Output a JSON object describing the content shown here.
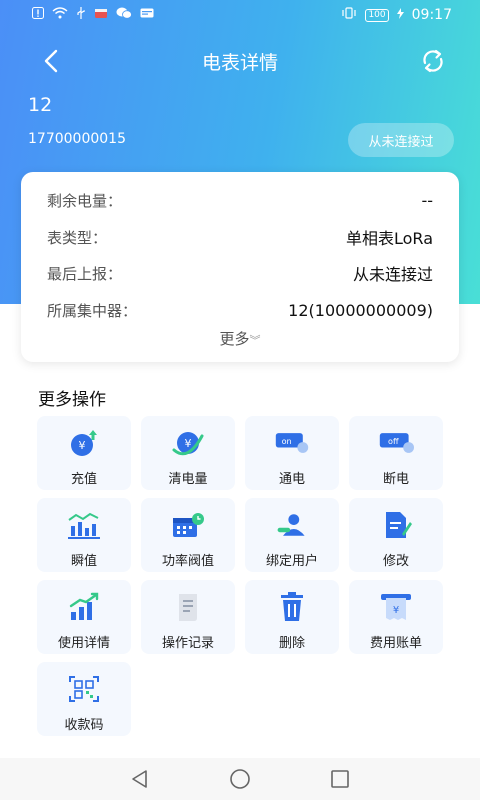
{
  "status_bar": {
    "battery": "100",
    "time": "09:17"
  },
  "header": {
    "title": "电表详情"
  },
  "meter": {
    "name": "12",
    "phone": "17700000015",
    "connection_status": "从未连接过"
  },
  "info": {
    "rows": [
      {
        "label": "剩余电量：",
        "value": "--"
      },
      {
        "label": "表类型：",
        "value": "单相表LoRa"
      },
      {
        "label": "最后上报：",
        "value": "从未连接过"
      },
      {
        "label": "所属集中器：",
        "value": "12(10000000009)"
      }
    ],
    "more_label": "更多"
  },
  "operations": {
    "title": "更多操作",
    "items": [
      {
        "label": "充值",
        "icon": "recharge-icon"
      },
      {
        "label": "清电量",
        "icon": "clear-power-icon"
      },
      {
        "label": "通电",
        "icon": "power-on-icon",
        "badge": "on"
      },
      {
        "label": "断电",
        "icon": "power-off-icon",
        "badge": "off"
      },
      {
        "label": "瞬值",
        "icon": "instant-value-icon"
      },
      {
        "label": "功率阀值",
        "icon": "power-threshold-icon"
      },
      {
        "label": "绑定用户",
        "icon": "bind-user-icon"
      },
      {
        "label": "修改",
        "icon": "edit-icon"
      },
      {
        "label": "使用详情",
        "icon": "usage-detail-icon"
      },
      {
        "label": "操作记录",
        "icon": "operation-log-icon"
      },
      {
        "label": "删除",
        "icon": "delete-icon"
      },
      {
        "label": "费用账单",
        "icon": "bill-icon"
      },
      {
        "label": "收款码",
        "icon": "qr-code-icon"
      }
    ]
  },
  "colors": {
    "primary": "#4b8ff7",
    "accent": "#49dfd6",
    "icon_blue": "#2f6fe6",
    "icon_green": "#35c98a"
  }
}
